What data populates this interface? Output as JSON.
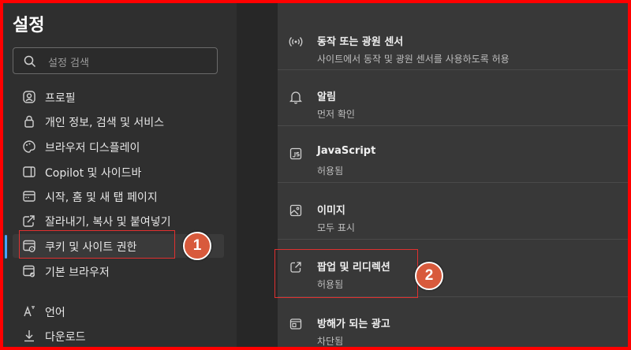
{
  "sidebar": {
    "title": "설정",
    "search_placeholder": "설정 검색",
    "items": [
      {
        "label": "프로필",
        "icon": "profile-icon"
      },
      {
        "label": "개인 정보, 검색 및 서비스",
        "icon": "lock-icon"
      },
      {
        "label": "브라우저 디스플레이",
        "icon": "palette-icon"
      },
      {
        "label": "Copilot 및 사이드바",
        "icon": "sidebar-icon"
      },
      {
        "label": "시작, 홈 및 새 탭 페이지",
        "icon": "home-tab-icon"
      },
      {
        "label": "잘라내기, 복사 및 붙여넣기",
        "icon": "share-icon"
      },
      {
        "label": "쿠키 및 사이트 권한",
        "icon": "cookie-permissions-icon",
        "active": true
      },
      {
        "label": "기본 브라우저",
        "icon": "default-browser-icon"
      },
      {
        "label": "언어",
        "icon": "language-icon"
      },
      {
        "label": "다운로드",
        "icon": "download-icon"
      }
    ]
  },
  "permissions": [
    {
      "title": "동작 또는 광원 센서",
      "subtitle": "사이트에서 동작 및 광원 센서를 사용하도록 허용",
      "icon": "sensor-icon"
    },
    {
      "title": "알림",
      "subtitle": "먼저 확인",
      "icon": "bell-icon"
    },
    {
      "title": "JavaScript",
      "subtitle": "허용됨",
      "icon": "javascript-icon"
    },
    {
      "title": "이미지",
      "subtitle": "모두 표시",
      "icon": "image-icon"
    },
    {
      "title": "팝업 및 리디렉션",
      "subtitle": "허용됨",
      "icon": "external-link-icon"
    },
    {
      "title": "방해가 되는 광고",
      "subtitle": "차단됨",
      "icon": "ad-icon"
    }
  ],
  "annotations": {
    "step1": "1",
    "step2": "2",
    "highlight_color": "#e0302f",
    "badge_color": "#d85a3c"
  },
  "colors": {
    "accent": "#4aa3ff",
    "frame": "#ff0000"
  }
}
